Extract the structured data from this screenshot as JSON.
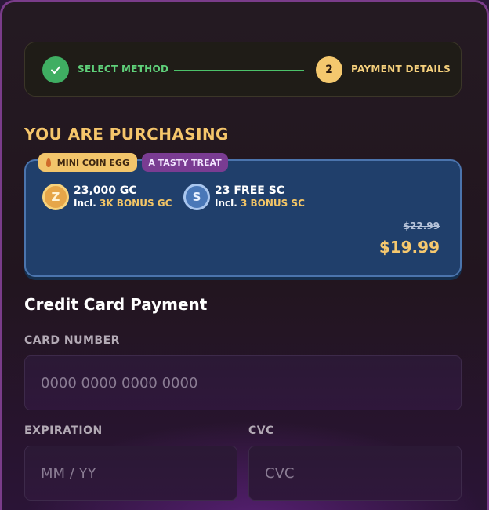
{
  "stepper": {
    "step1": {
      "label": "SELECT METHOD",
      "status": "complete"
    },
    "step2": {
      "number": "2",
      "label": "PAYMENT DETAILS",
      "status": "active"
    }
  },
  "purchase": {
    "heading": "YOU ARE PURCHASING",
    "badges": {
      "product": "MINI COIN EGG",
      "tag": "A TASTY TREAT"
    },
    "gold_coins": {
      "icon_letter": "Z",
      "amount": "23,000 GC",
      "incl_prefix": "Incl.",
      "bonus": "3K BONUS GC"
    },
    "sweeps_coins": {
      "icon_letter": "S",
      "amount": "23 FREE SC",
      "incl_prefix": "Incl.",
      "bonus": "3 BONUS SC"
    },
    "original_price": "$22.99",
    "price": "$19.99"
  },
  "form": {
    "title": "Credit Card Payment",
    "card_number": {
      "label": "CARD NUMBER",
      "placeholder": "0000 0000 0000 0000",
      "value": ""
    },
    "expiration": {
      "label": "EXPIRATION",
      "placeholder": "MM / YY",
      "value": ""
    },
    "cvc": {
      "label": "CVC",
      "placeholder": "CVC",
      "value": ""
    }
  },
  "colors": {
    "accent_gold": "#f5c66b",
    "success_green": "#3fae62",
    "card_blue": "#203f6b",
    "tag_purple": "#7a3c92"
  }
}
